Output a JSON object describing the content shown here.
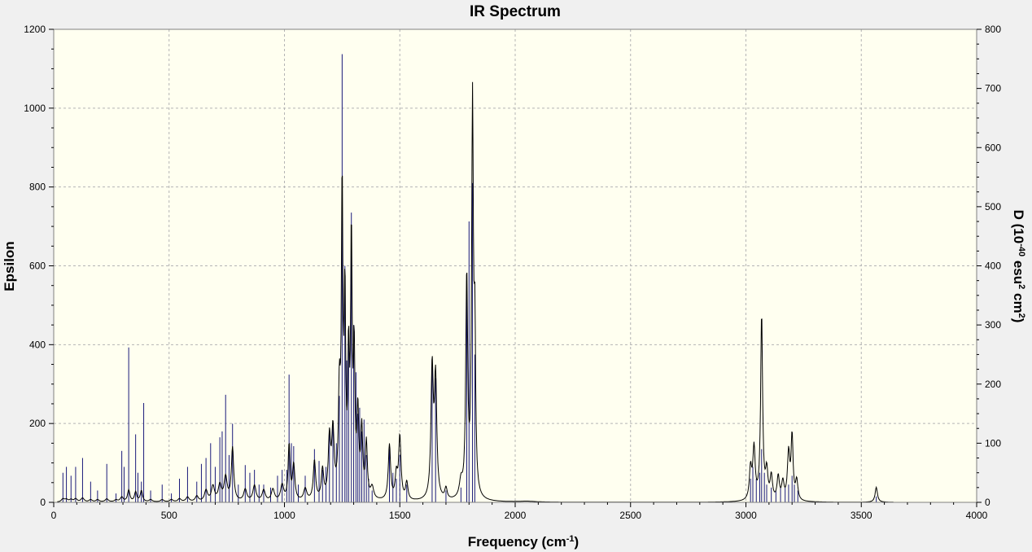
{
  "chart_data": {
    "type": "line",
    "title": "IR Spectrum",
    "xlabel": {
      "main": "Frequency (cm",
      "sup": "-1",
      "tail": ")"
    },
    "ylabel": "Epsilon",
    "y2label": {
      "p1": "D (10",
      "s1": "-40",
      "p2": " esu",
      "s2": "2",
      "p3": " cm",
      "s3": "2",
      "p4": ")"
    },
    "xlim": [
      0,
      4000
    ],
    "ylim": [
      0,
      1200
    ],
    "y2lim": [
      0,
      800
    ],
    "x_ticks": [
      0,
      500,
      1000,
      1500,
      2000,
      2500,
      3000,
      3500,
      4000
    ],
    "y_ticks": [
      0,
      200,
      400,
      600,
      800,
      1000,
      1200
    ],
    "y2_ticks": [
      0,
      100,
      200,
      300,
      400,
      500,
      600,
      700,
      800
    ],
    "grid": true,
    "colors": {
      "spectrum": "#000000",
      "sticks": "#1a1a7a",
      "plot_bg": "#fffff0",
      "grid": "#b4b4b4"
    },
    "series": [
      {
        "kind": "spectrum",
        "axis": "epsilon",
        "baseline": 2,
        "peaks": [
          [
            40,
            8,
            8
          ],
          [
            55,
            6,
            8
          ],
          [
            75,
            6,
            8
          ],
          [
            95,
            8,
            8
          ],
          [
            125,
            10,
            8
          ],
          [
            160,
            6,
            8
          ],
          [
            190,
            6,
            8
          ],
          [
            230,
            8,
            8
          ],
          [
            270,
            5,
            8
          ],
          [
            295,
            12,
            8
          ],
          [
            325,
            30,
            6
          ],
          [
            355,
            25,
            6
          ],
          [
            380,
            28,
            6
          ],
          [
            420,
            6,
            8
          ],
          [
            470,
            6,
            8
          ],
          [
            510,
            6,
            8
          ],
          [
            545,
            8,
            8
          ],
          [
            580,
            12,
            8
          ],
          [
            620,
            14,
            8
          ],
          [
            660,
            28,
            8
          ],
          [
            690,
            38,
            8
          ],
          [
            720,
            40,
            8
          ],
          [
            745,
            60,
            8
          ],
          [
            775,
            135,
            6
          ],
          [
            830,
            30,
            8
          ],
          [
            870,
            40,
            8
          ],
          [
            910,
            28,
            8
          ],
          [
            950,
            30,
            8
          ],
          [
            990,
            40,
            8
          ],
          [
            1020,
            140,
            5
          ],
          [
            1040,
            90,
            6
          ],
          [
            1090,
            30,
            8
          ],
          [
            1130,
            100,
            6
          ],
          [
            1165,
            75,
            6
          ],
          [
            1195,
            150,
            6
          ],
          [
            1210,
            165,
            6
          ],
          [
            1238,
            250,
            5
          ],
          [
            1250,
            760,
            4
          ],
          [
            1262,
            480,
            4
          ],
          [
            1278,
            330,
            4
          ],
          [
            1290,
            640,
            4
          ],
          [
            1302,
            350,
            4
          ],
          [
            1318,
            210,
            5
          ],
          [
            1335,
            170,
            5
          ],
          [
            1355,
            140,
            5
          ],
          [
            1380,
            30,
            8
          ],
          [
            1455,
            140,
            6
          ],
          [
            1485,
            60,
            6
          ],
          [
            1500,
            160,
            6
          ],
          [
            1530,
            45,
            6
          ],
          [
            1640,
            330,
            6
          ],
          [
            1655,
            300,
            6
          ],
          [
            1700,
            28,
            6
          ],
          [
            1765,
            40,
            8
          ],
          [
            1790,
            560,
            5
          ],
          [
            1815,
            990,
            4.5
          ],
          [
            1825,
            380,
            4
          ],
          [
            2050,
            2,
            40
          ],
          [
            3020,
            80,
            6
          ],
          [
            3035,
            130,
            6
          ],
          [
            3068,
            470,
            5
          ],
          [
            3090,
            70,
            6
          ],
          [
            3110,
            60,
            6
          ],
          [
            3140,
            60,
            6
          ],
          [
            3160,
            45,
            6
          ],
          [
            3185,
            120,
            6
          ],
          [
            3200,
            160,
            5
          ],
          [
            3220,
            50,
            6
          ],
          [
            3565,
            38,
            6
          ]
        ]
      },
      {
        "kind": "stick",
        "axis": "dipole",
        "sticks": [
          [
            40,
            50
          ],
          [
            55,
            60
          ],
          [
            75,
            45
          ],
          [
            95,
            60
          ],
          [
            125,
            75
          ],
          [
            160,
            35
          ],
          [
            190,
            20
          ],
          [
            230,
            65
          ],
          [
            270,
            15
          ],
          [
            295,
            87
          ],
          [
            305,
            60
          ],
          [
            325,
            262
          ],
          [
            355,
            115
          ],
          [
            365,
            50
          ],
          [
            380,
            35
          ],
          [
            390,
            168
          ],
          [
            420,
            20
          ],
          [
            470,
            30
          ],
          [
            510,
            15
          ],
          [
            545,
            40
          ],
          [
            580,
            60
          ],
          [
            620,
            35
          ],
          [
            640,
            65
          ],
          [
            660,
            75
          ],
          [
            680,
            100
          ],
          [
            700,
            60
          ],
          [
            720,
            110
          ],
          [
            730,
            120
          ],
          [
            745,
            182
          ],
          [
            760,
            80
          ],
          [
            775,
            133
          ],
          [
            800,
            30
          ],
          [
            830,
            63
          ],
          [
            850,
            50
          ],
          [
            870,
            55
          ],
          [
            890,
            30
          ],
          [
            910,
            30
          ],
          [
            940,
            25
          ],
          [
            970,
            45
          ],
          [
            990,
            55
          ],
          [
            1010,
            55
          ],
          [
            1020,
            216
          ],
          [
            1030,
            100
          ],
          [
            1040,
            95
          ],
          [
            1060,
            30
          ],
          [
            1090,
            45
          ],
          [
            1130,
            90
          ],
          [
            1150,
            70
          ],
          [
            1165,
            55
          ],
          [
            1180,
            60
          ],
          [
            1195,
            120
          ],
          [
            1210,
            130
          ],
          [
            1225,
            100
          ],
          [
            1238,
            180
          ],
          [
            1250,
            758
          ],
          [
            1262,
            400
          ],
          [
            1270,
            240
          ],
          [
            1278,
            280
          ],
          [
            1290,
            490
          ],
          [
            1300,
            300
          ],
          [
            1310,
            220
          ],
          [
            1318,
            150
          ],
          [
            1326,
            160
          ],
          [
            1335,
            120
          ],
          [
            1345,
            140
          ],
          [
            1355,
            80
          ],
          [
            1365,
            40
          ],
          [
            1380,
            20
          ],
          [
            1455,
            90
          ],
          [
            1470,
            50
          ],
          [
            1485,
            40
          ],
          [
            1500,
            80
          ],
          [
            1530,
            30
          ],
          [
            1640,
            230
          ],
          [
            1655,
            210
          ],
          [
            1700,
            20
          ],
          [
            1765,
            25
          ],
          [
            1790,
            375
          ],
          [
            1800,
            475
          ],
          [
            1815,
            540
          ],
          [
            1825,
            250
          ],
          [
            3020,
            40
          ],
          [
            3030,
            60
          ],
          [
            3045,
            40
          ],
          [
            3060,
            50
          ],
          [
            3068,
            90
          ],
          [
            3080,
            50
          ],
          [
            3090,
            30
          ],
          [
            3110,
            25
          ],
          [
            3130,
            20
          ],
          [
            3150,
            25
          ],
          [
            3170,
            25
          ],
          [
            3185,
            30
          ],
          [
            3200,
            45
          ],
          [
            3210,
            30
          ],
          [
            3225,
            20
          ],
          [
            3565,
            10
          ]
        ]
      }
    ]
  }
}
